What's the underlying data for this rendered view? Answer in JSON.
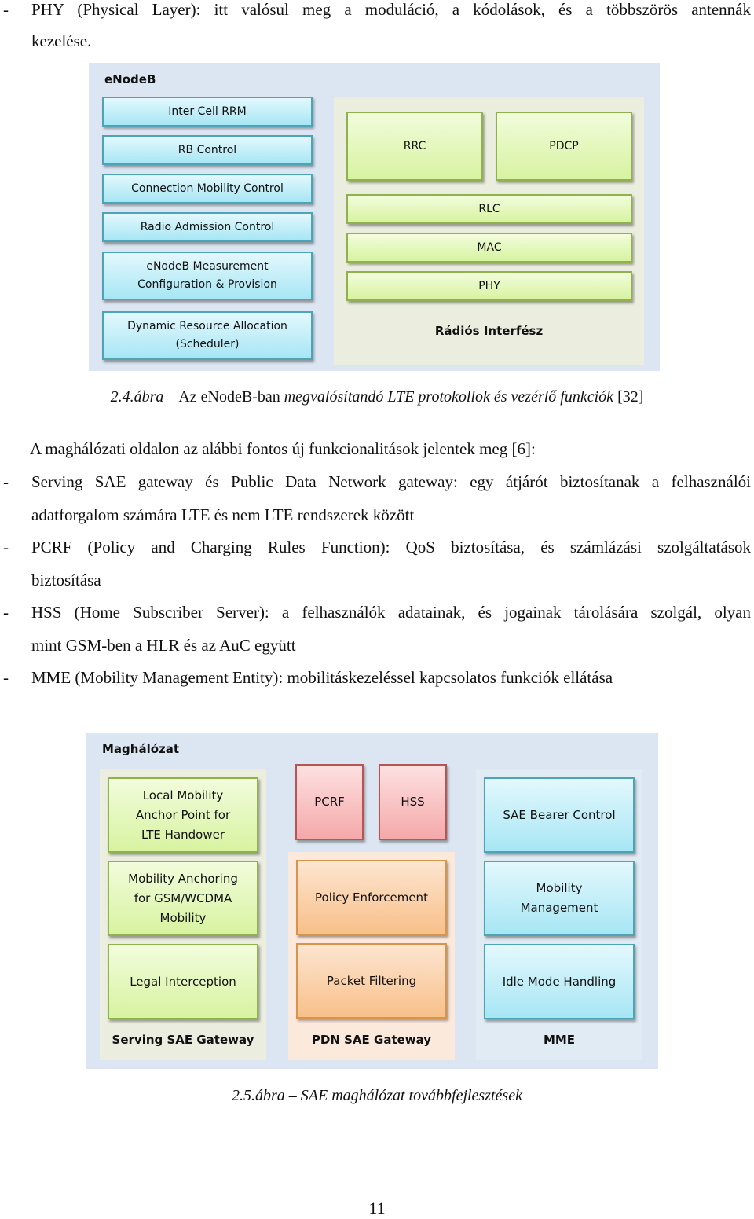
{
  "intro_bullet": {
    "dash": "-",
    "line1": "PHY (Physical Layer): itt valósul meg a moduláció, a kódolások, és a többszörös antennák",
    "line2": "kezelése."
  },
  "figure1": {
    "title": "eNodeB",
    "control_functions": [
      "Inter Cell RRM",
      "RB Control",
      "Connection Mobility Control",
      "Radio Admission Control",
      "eNodeB Measurement\nConfiguration & Provision",
      "Dynamic Resource Allocation\n(Scheduler)"
    ],
    "radio_interface": {
      "label": "Rádiós Interfész",
      "top_row": [
        "RRC",
        "PDCP"
      ],
      "layers": [
        "RLC",
        "MAC",
        "PHY"
      ]
    },
    "colors": {
      "background": "#dce6f2",
      "blue_box": "#a7e6f4",
      "green_box": "#d7f3a0",
      "panel": "#ebeedf"
    },
    "caption": {
      "number": "2.4.ábra",
      "dash": " – ",
      "regular1": "Az eNodeB-ban ",
      "italic": "megvalósítandó LTE protokollok és vezérlő funkciók",
      "ref": " [32]"
    }
  },
  "body": {
    "intro": "A maghálózati oldalon az alábbi fontos új funkcionalitások jelentek meg [6]:",
    "bullets": [
      {
        "dash": "-",
        "line1": "Serving SAE gateway és Public Data Network gateway: egy átjárót biztosítanak a felhasználói",
        "line2": "adatforgalom számára LTE és nem LTE rendszerek között"
      },
      {
        "dash": "-",
        "line1": "PCRF (Policy and Charging Rules Function): QoS biztosítása, és számlázási szolgáltatások",
        "line2": "biztosítása"
      },
      {
        "dash": "-",
        "line1": "HSS (Home Subscriber Server): a felhasználók adatainak, és jogainak tárolására szolgál, olyan",
        "line2": "mint GSM-ben a HLR és az AuC együtt"
      },
      {
        "dash": "-",
        "line1": "MME (Mobility Management Entity): mobilitáskezeléssel kapcsolatos funkciók ellátása"
      }
    ]
  },
  "figure2": {
    "title": "Maghálózat",
    "serving_gw": {
      "label": "Serving SAE Gateway",
      "boxes": [
        "Local Mobility\nAnchor Point for\nLTE Handower",
        "Mobility Anchoring\nfor GSM/WCDMA\nMobility",
        "Legal Interception"
      ]
    },
    "standalone": [
      "PCRF",
      "HSS"
    ],
    "pdn_gw": {
      "label": "PDN SAE Gateway",
      "boxes": [
        "Policy Enforcement",
        "Packet Filtering"
      ]
    },
    "mme": {
      "label": "MME",
      "boxes": [
        "SAE Bearer Control",
        "Mobility\nManagement",
        "Idle Mode Handling"
      ]
    },
    "colors": {
      "red_box": "#f5a9aa",
      "orange_box": "#f8c08a",
      "orange_panel": "#fbe9dc"
    },
    "caption": {
      "text": "2.5.ábra – SAE maghálózat továbbfejlesztések"
    }
  },
  "page_number": "11"
}
